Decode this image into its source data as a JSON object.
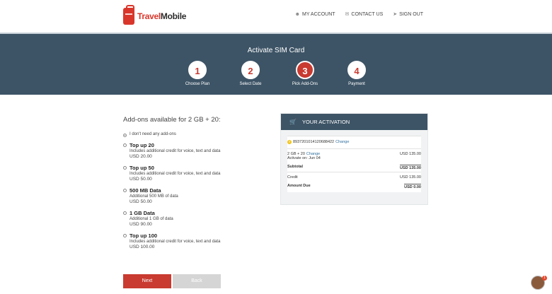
{
  "header": {
    "logo_text_a": "Travel",
    "logo_text_b": "Mobile",
    "links": {
      "account": "MY ACCOUNT",
      "contact": "CONTACT US",
      "signout": "SIGN OUT"
    }
  },
  "banner": {
    "title": "Activate SIM Card",
    "steps": [
      {
        "number": "1",
        "label": "Choose Plan"
      },
      {
        "number": "2",
        "label": "Select Date"
      },
      {
        "number": "3",
        "label": "Pick Add-Ons"
      },
      {
        "number": "4",
        "label": "Payment"
      }
    ],
    "active_step": 3
  },
  "addons": {
    "title": "Add-ons available for 2 GB + 20:",
    "none_label": "I don't need any add-ons",
    "options": [
      {
        "name": "Top up 20",
        "desc": "Includes additional credit for voice, text and data",
        "price": "USD 20.00"
      },
      {
        "name": "Top up 50",
        "desc": "Includes additional credit for voice, text and data",
        "price": "USD 50.00"
      },
      {
        "name": "500 MB Data",
        "desc": "Additional 500 MB of data",
        "price": "USD 50.00"
      },
      {
        "name": "1 GB Data",
        "desc": "Additional 1 GB of data",
        "price": "USD 90.00"
      },
      {
        "name": "Top up 100",
        "desc": "Includes additional credit for voice, text and data",
        "price": "USD 100.00"
      }
    ]
  },
  "buttons": {
    "next": "Next",
    "back": "Back"
  },
  "activation": {
    "title": "YOUR ACTIVATION",
    "sim_number": "8937201014120688422",
    "change_label": "Change",
    "plan_name": "2 GB + 20",
    "plan_change_label": "Change",
    "activate_on": "Activate on: Jun 04",
    "plan_price": "USD 135.00",
    "subtotal_label": "Subtotal",
    "subtotal_value": "USD 135.00",
    "credit_label": "Credit",
    "credit_value": "USD 135.00",
    "amount_due_label": "Amount Due",
    "amount_due_value": "USD 0.00"
  },
  "notification_count": "1",
  "colors": {
    "brand_red": "#c93a30",
    "banner": "#3d5466"
  }
}
